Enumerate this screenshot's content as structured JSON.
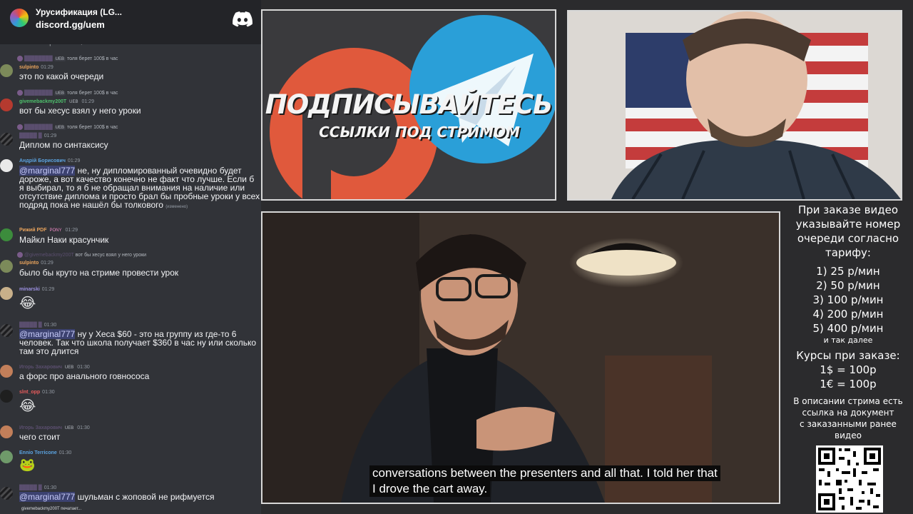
{
  "discord": {
    "server_name": "Урусификация (LG...",
    "invite": "discord.gg/uem",
    "messages": [
      {
        "reply": "толя берет 100$ в час",
        "author": "sulpinto",
        "time": "01:29",
        "text": "это по какой очереди"
      },
      {
        "reply": "толя берет 100$ в час",
        "author": "givemebackmy200T",
        "badge": "UEB",
        "time": "01:29",
        "text": "вот бы хесус взял у него уроки"
      },
      {
        "reply": "толя берет 100$ в час",
        "author": "",
        "time": "01:29",
        "text": "Диплом по синтаксису"
      },
      {
        "author": "Андрій Борисович",
        "time": "01:29",
        "mention": "@marginal777",
        "text": " не, ну дипломированный очевидно будет дороже, а вот качество конечно не факт что лучше. Если б я выбирал, то я б не обращал внимания на наличие или отсутствие диплома и просто брал бы пробные уроки у всех подряд пока не нашёл бы толкового",
        "edited": "(изменено)"
      },
      {
        "author": "Рижий PDF",
        "badge": "PONY",
        "time": "01:29",
        "text": "Майкл Наки красунчик"
      },
      {
        "reply": "вот бы хесус взял у него уроки",
        "reply_author": "@givemebackmy200T",
        "author": "sulpinto",
        "time": "01:29",
        "text": "было бы круто на стриме провести урок"
      },
      {
        "author": "minarski",
        "time": "01:29",
        "text": "",
        "emoji": "😂"
      },
      {
        "author": "",
        "time": "01:30",
        "mention": "@marginal777",
        "text": " ну у Хеса $60 - это на группу из где-то 6 человек. Так что школа получает $360 в час ну или сколько там это длится"
      },
      {
        "author": "Игорь Захарович",
        "badge": "UEB",
        "time": "01:30",
        "text": "а  форс про анального говнососа"
      },
      {
        "author": "slnt_opp",
        "time": "01:30",
        "text": "",
        "emoji": "😂"
      },
      {
        "author": "Игорь Захарович",
        "badge": "UEB",
        "time": "01:30",
        "text": "чего стоит"
      },
      {
        "author": "Ennio Terricone",
        "time": "01:30",
        "text": "",
        "emoji": "🐸"
      },
      {
        "author": "",
        "time": "01:30",
        "mention": "@marginal777",
        "text": " шульман с жоповой не рифмуется"
      }
    ],
    "top_partial": "толя берет 100$ в час",
    "typing": "givemebackmy200T печатает..."
  },
  "promo": {
    "title": "ПОДПИСЫВАЙТЕСЬ",
    "subtitle": "ССЫЛКИ ПОД СТРИМОМ"
  },
  "video": {
    "subtitle_line1": "conversations between the presenters and all that. I told her that",
    "subtitle_line2": "I drove the cart away."
  },
  "info": {
    "heading": [
      "При заказе видео",
      "указывайте номер",
      "очереди согласно",
      "тарифу:"
    ],
    "tariffs": [
      "1) 25 р/мин",
      "2) 50 р/мин",
      "3) 100 р/мин",
      "4) 200 р/мин",
      "5) 400 р/мин"
    ],
    "etc": "и так далее",
    "rates_title": "Курсы при заказе:",
    "rates": [
      "1$ = 100р",
      "1€ = 100р"
    ],
    "desc": [
      "В описании стрима есть",
      "ссылка на документ",
      "с заказанными ранее",
      "видео"
    ]
  },
  "colors": {
    "discord_bg": "#313338",
    "discord_header": "#232428",
    "patreon": "#e0593c",
    "telegram": "#2a9fd8",
    "mention_bg": "#3c4270"
  }
}
